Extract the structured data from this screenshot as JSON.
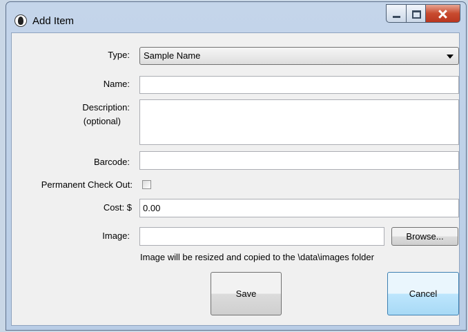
{
  "window": {
    "title": "Add Item"
  },
  "form": {
    "type_label": "Type:",
    "type_value": "Sample Name",
    "name_label": "Name:",
    "name_value": "",
    "description_label": "Description:",
    "description_optional": "(optional)",
    "description_value": "",
    "barcode_label": "Barcode:",
    "barcode_value": "",
    "permanent_label": "Permanent Check Out:",
    "permanent_checked": false,
    "cost_label": "Cost:  $",
    "cost_value": "0.00",
    "image_label": "Image:",
    "image_value": "",
    "browse_label": "Browse...",
    "image_hint": "Image will be resized and copied to the \\data\\images folder"
  },
  "buttons": {
    "save_label": "Save",
    "cancel_label": "Cancel"
  }
}
